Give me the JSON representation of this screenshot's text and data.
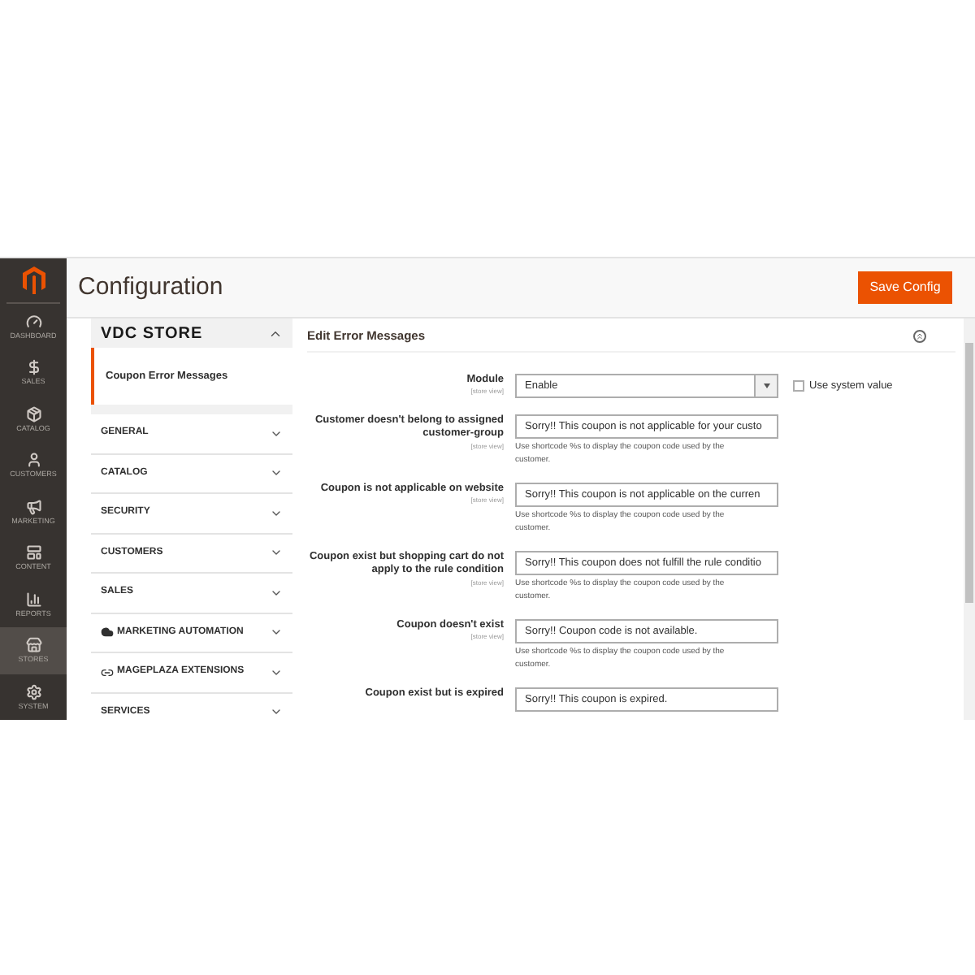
{
  "nav": [
    {
      "label": "DASHBOARD",
      "kind": "dashboard",
      "selected": false
    },
    {
      "label": "SALES",
      "kind": "sales",
      "selected": false
    },
    {
      "label": "CATALOG",
      "kind": "catalog",
      "selected": false
    },
    {
      "label": "CUSTOMERS",
      "kind": "customers",
      "selected": false
    },
    {
      "label": "MARKETING",
      "kind": "marketing",
      "selected": false
    },
    {
      "label": "CONTENT",
      "kind": "content",
      "selected": false
    },
    {
      "label": "REPORTS",
      "kind": "reports",
      "selected": false
    },
    {
      "label": "STORES",
      "kind": "stores",
      "selected": true
    },
    {
      "label": "SYSTEM",
      "kind": "system",
      "selected": false
    }
  ],
  "header": {
    "title": "Configuration",
    "save_button": "Save Config"
  },
  "config_tabs": {
    "group": {
      "title": "VDC STORE",
      "expanded": true,
      "items": [
        {
          "label": "Coupon Error Messages",
          "selected": true
        }
      ]
    },
    "sections": [
      {
        "label": "GENERAL",
        "kind": "plain"
      },
      {
        "label": "CATALOG",
        "kind": "plain"
      },
      {
        "label": "SECURITY",
        "kind": "plain"
      },
      {
        "label": "CUSTOMERS",
        "kind": "plain"
      },
      {
        "label": "SALES",
        "kind": "plain"
      },
      {
        "label": "MARKETING AUTOMATION",
        "kind": "automation"
      },
      {
        "label": "MAGEPLAZA EXTENSIONS",
        "kind": "mageplaza"
      },
      {
        "label": "SERVICES",
        "kind": "plain"
      }
    ]
  },
  "section": {
    "title": "Edit Error Messages",
    "expanded": true,
    "fields": [
      {
        "kind": "select",
        "label": "Module",
        "scope": "[store view]",
        "value": "Enable",
        "use_system_value": {
          "label": "Use system value",
          "checked": false
        }
      },
      {
        "kind": "text",
        "label": "Customer doesn't belong to assigned customer-group",
        "scope": "[store view]",
        "value": "Sorry!! This coupon is not applicable for your custo",
        "hint": "Use shortcode %s to display the coupon code used by the customer."
      },
      {
        "kind": "text",
        "label": "Coupon is not applicable on website",
        "scope": "[store view]",
        "value": "Sorry!! This coupon is not applicable on the curren",
        "hint": "Use shortcode %s to display the coupon code used by the customer."
      },
      {
        "kind": "text",
        "label": "Coupon exist but shopping cart do not apply to the rule condition",
        "scope": "[store view]",
        "value": "Sorry!! This coupon does not fulfill the rule conditio",
        "hint": "Use shortcode %s to display the coupon code used by the customer."
      },
      {
        "kind": "text",
        "label": "Coupon doesn't exist",
        "scope": "[store view]",
        "value": "Sorry!! Coupon code is not available.",
        "hint": "Use shortcode %s to display the coupon code used by the customer."
      },
      {
        "kind": "text",
        "label": "Coupon exist but is expired",
        "value": "Sorry!! This coupon is expired."
      }
    ]
  }
}
